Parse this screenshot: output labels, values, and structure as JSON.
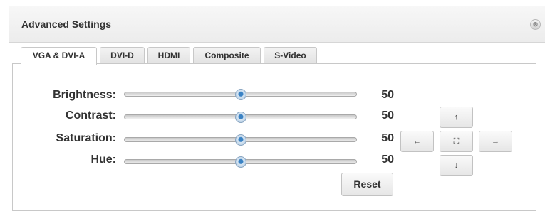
{
  "window": {
    "title": "Advanced Settings",
    "close_glyph": "⊗"
  },
  "tabs": [
    {
      "label": "VGA & DVI-A",
      "active": true
    },
    {
      "label": "DVI-D",
      "active": false
    },
    {
      "label": "HDMI",
      "active": false
    },
    {
      "label": "Composite",
      "active": false
    },
    {
      "label": "S-Video",
      "active": false
    }
  ],
  "sliders": [
    {
      "label": "Brightness:",
      "value": "50",
      "fraction": 0.5
    },
    {
      "label": "Contrast:",
      "value": "50",
      "fraction": 0.5
    },
    {
      "label": "Saturation:",
      "value": "50",
      "fraction": 0.5
    },
    {
      "label": "Hue:",
      "value": "50",
      "fraction": 0.5
    }
  ],
  "reset_label": "Reset",
  "position_pad": {
    "up": "↑",
    "left": "←",
    "center": "⛶",
    "right": "→",
    "down": "↓"
  },
  "colors": {
    "thumb_center": "#3a82c4"
  }
}
